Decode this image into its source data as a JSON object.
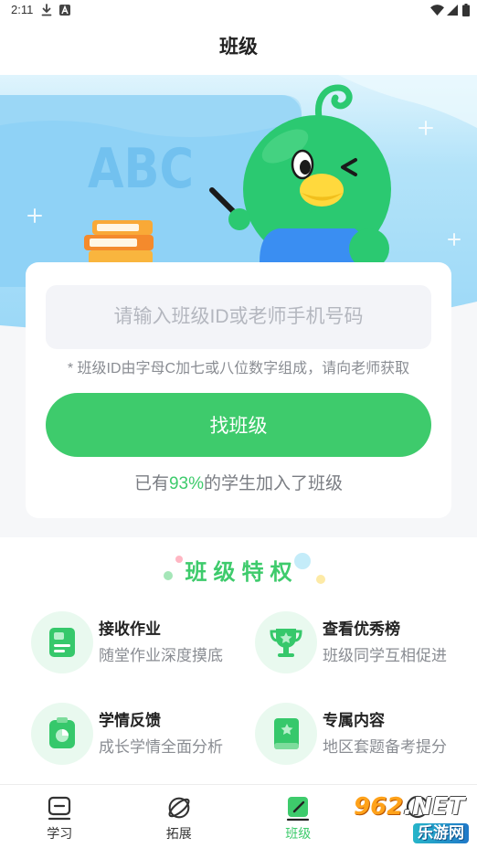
{
  "status_bar": {
    "time": "2:11",
    "left_icons": [
      "download-icon",
      "a-notification-icon"
    ],
    "right_icons": [
      "wifi-icon",
      "signal-icon",
      "battery-icon"
    ]
  },
  "header": {
    "title": "班级"
  },
  "banner": {
    "board_text": "ABC"
  },
  "join_card": {
    "input": {
      "placeholder": "请输入班级ID或老师手机号码",
      "value": ""
    },
    "hint": "* 班级ID由字母C加七或八位数字组成，请向老师获取",
    "button_label": "找班级",
    "stat": {
      "prefix": "已有",
      "value": "93%",
      "suffix": "的学生加入了班级"
    }
  },
  "privileges": {
    "title": "班级特权",
    "items": [
      {
        "title": "接收作业",
        "subtitle": "随堂作业深度摸底",
        "icon": "homework-icon"
      },
      {
        "title": "查看优秀榜",
        "subtitle": "班级同学互相促进",
        "icon": "trophy-icon"
      },
      {
        "title": "学情反馈",
        "subtitle": "成长学情全面分析",
        "icon": "report-icon"
      },
      {
        "title": "专属内容",
        "subtitle": "地区套题备考提分",
        "icon": "star-book-icon"
      }
    ]
  },
  "tab_bar": {
    "tabs": [
      {
        "label": "学习",
        "icon": "study-icon",
        "active": false
      },
      {
        "label": "拓展",
        "icon": "planet-icon",
        "active": false
      },
      {
        "label": "班级",
        "icon": "class-icon",
        "active": true
      },
      {
        "icon": "tab-icon",
        "active": false
      }
    ]
  },
  "watermark": {
    "number": "962",
    "suffix": ".NET",
    "name": "乐游网"
  },
  "colors": {
    "accent": "#3ecb6c",
    "banner_top": "#dff4fd",
    "banner_bottom": "#9bd8f7",
    "mascot": "#2bc971",
    "beak": "#ffd93d",
    "shirt": "#3a8ef2",
    "books": "#f7a233",
    "input_bg": "#f3f4f8",
    "icon_circle_bg": "#e9f9ef"
  }
}
